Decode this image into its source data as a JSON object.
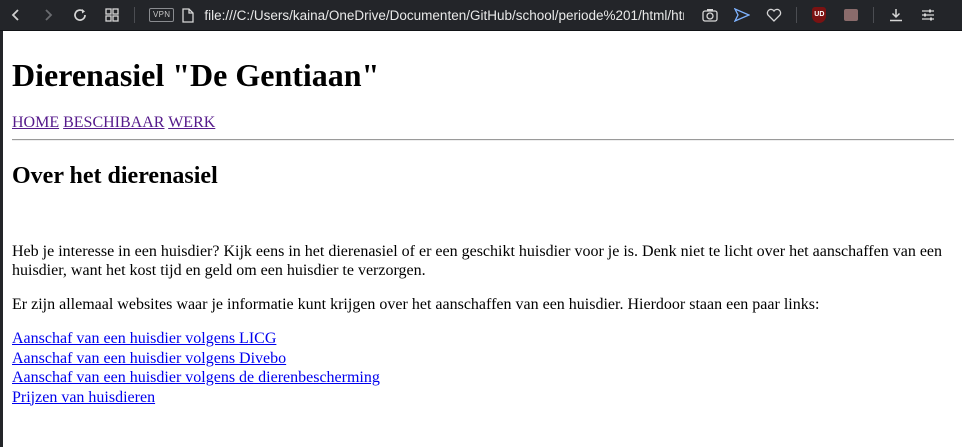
{
  "browser": {
    "url": "file:///C:/Users/kaina/OneDrive/Documenten/GitHub/school/periode%201/html/htm",
    "vpn_label": "VPN",
    "ublock_label": "UD"
  },
  "page": {
    "title": "Dierenasiel \"De Gentiaan\"",
    "nav": [
      {
        "label": "HOME"
      },
      {
        "label": "BESCHIBAAR"
      },
      {
        "label": "WERK"
      }
    ],
    "section_heading": "Over het dierenasiel",
    "paragraph_1": "Heb je interesse in een huisdier? Kijk eens in het dierenasiel of er een geschikt huisdier voor je is. Denk niet te licht over het aanschaffen van een huisdier, want het kost tijd en geld om een huisdier te verzorgen.",
    "paragraph_2": "Er zijn allemaal websites waar je informatie kunt krijgen over het aanschaffen van een huisdier. Hierdoor staan een paar links:",
    "links": [
      {
        "label": "Aanschaf van een huisdier volgens LICG"
      },
      {
        "label": "Aanschaf van een huisdier volgens Divebo"
      },
      {
        "label": "Aanschaf van een huisdier volgens de dierenbescherming"
      },
      {
        "label": "Prijzen van huisdieren"
      }
    ]
  },
  "colors": {
    "toolbar_bg": "#232529",
    "visited_link": "#551a8b",
    "link": "#0000ee"
  }
}
